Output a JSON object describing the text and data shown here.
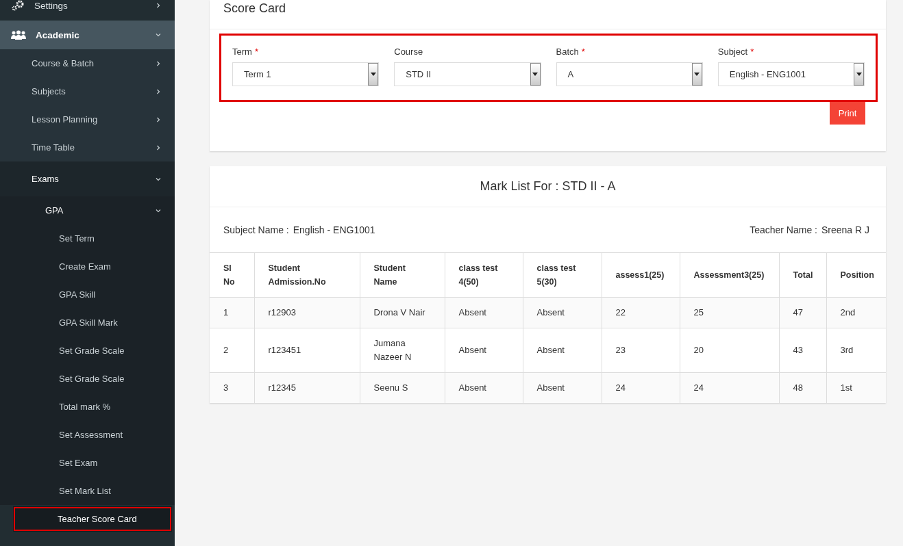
{
  "sidebar": {
    "items": [
      {
        "label": "Settings",
        "expanded": false
      },
      {
        "label": "Academic",
        "expanded": true,
        "children": [
          {
            "label": "Course & Batch",
            "expanded": false
          },
          {
            "label": "Subjects",
            "expanded": false
          },
          {
            "label": "Lesson Planning",
            "expanded": false
          },
          {
            "label": "Time Table",
            "expanded": false
          },
          {
            "label": "Exams",
            "expanded": true,
            "children": [
              {
                "label": "GPA",
                "expanded": true,
                "children": [
                  {
                    "label": "Set Term",
                    "selected": false,
                    "highlighted": false
                  },
                  {
                    "label": "Create Exam",
                    "selected": false,
                    "highlighted": false
                  },
                  {
                    "label": "GPA Skill",
                    "selected": false,
                    "highlighted": false
                  },
                  {
                    "label": "GPA Skill Mark",
                    "selected": false,
                    "highlighted": false
                  },
                  {
                    "label": "Set Grade Scale",
                    "selected": false,
                    "highlighted": false
                  },
                  {
                    "label": "Set Grade Scale",
                    "selected": false,
                    "highlighted": false
                  },
                  {
                    "label": "Total mark %",
                    "selected": false,
                    "highlighted": false
                  },
                  {
                    "label": "Set Assessment",
                    "selected": false,
                    "highlighted": false
                  },
                  {
                    "label": "Set Exam",
                    "selected": false,
                    "highlighted": false
                  },
                  {
                    "label": "Set Mark List",
                    "selected": false,
                    "highlighted": false
                  },
                  {
                    "label": "Teacher Score Card",
                    "selected": true,
                    "highlighted": true
                  }
                ]
              }
            ]
          }
        ]
      }
    ]
  },
  "score_card": {
    "title": "Score Card",
    "filters_highlighted": true,
    "filters": [
      {
        "label": "Term",
        "required_mark": "*",
        "value": "Term 1"
      },
      {
        "label": "Course",
        "value": "STD II"
      },
      {
        "label": "Batch",
        "required_mark": "*",
        "value": "A"
      },
      {
        "label": "Subject",
        "required_mark": "*",
        "value": "English - ENG1001"
      }
    ],
    "print_button": "Print"
  },
  "mark_list": {
    "title": "Mark List For : STD II - A",
    "subject_label": "Subject Name :",
    "subject_value": "English - ENG1001",
    "teacher_label": "Teacher Name :",
    "teacher_value": "Sreena R J",
    "columns": [
      "Sl No",
      "Student Admission.No",
      "Student Name",
      "class test 4(50)",
      "class test 5(30)",
      "assess1(25)",
      "Assessment3(25)",
      "Total",
      "Position"
    ],
    "rows": [
      [
        "1",
        "r12903",
        "Drona V Nair",
        "Absent",
        "Absent",
        "22",
        "25",
        "47",
        "2nd"
      ],
      [
        "2",
        "r123451",
        "Jumana Nazeer N",
        "Absent",
        "Absent",
        "23",
        "20",
        "43",
        "3rd"
      ],
      [
        "3",
        "r12345",
        "Seenu S",
        "Absent",
        "Absent",
        "24",
        "24",
        "48",
        "1st"
      ]
    ]
  }
}
